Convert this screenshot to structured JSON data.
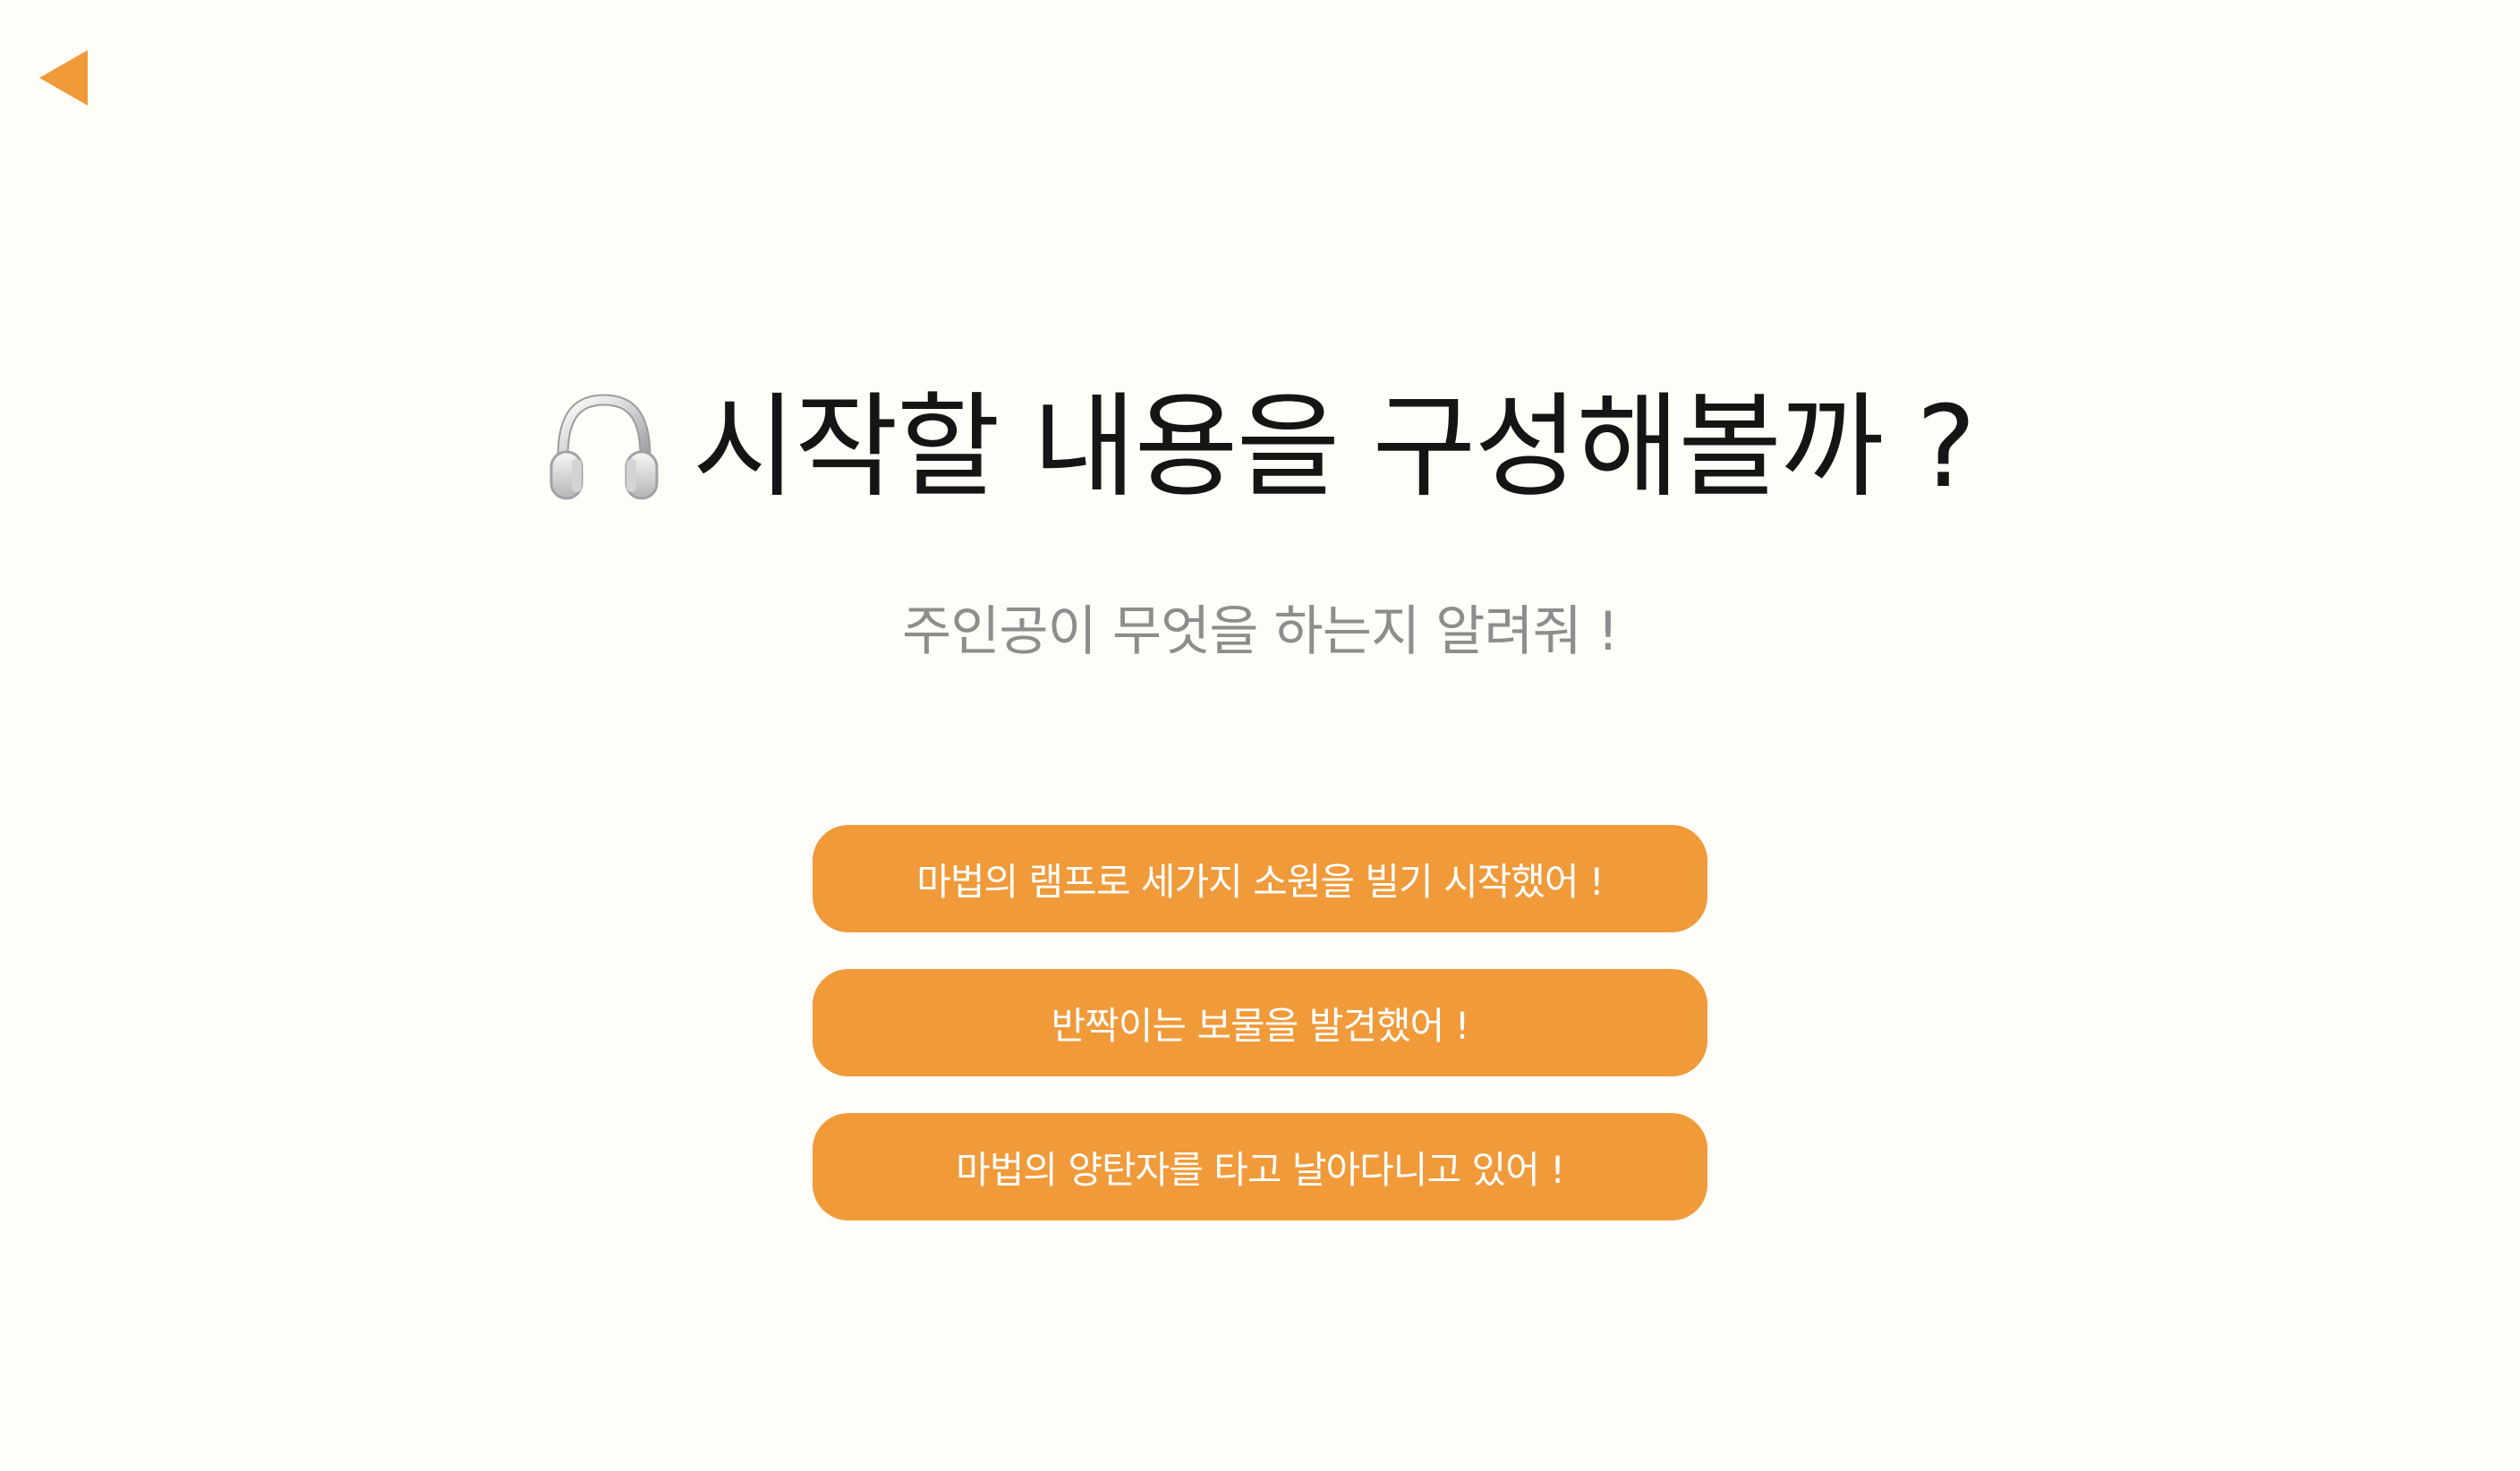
{
  "navigation": {
    "back_icon": "back-triangle-icon",
    "accent_color": "#f09a3a"
  },
  "header": {
    "icon": "headphones-icon",
    "title": "시작할 내용을 구성해볼까 ?",
    "subtitle": "주인공이 무엇을 하는지 알려줘 !"
  },
  "options": [
    {
      "label": "마법의 램프로 세가지 소원을 빌기 시작했어 !"
    },
    {
      "label": "반짝이는 보물을 발견했어 !"
    },
    {
      "label": "마법의 양탄자를 타고 날아다니고 있어 !"
    }
  ],
  "colors": {
    "background": "#fffdf7",
    "button": "#f09a3a",
    "title": "#151515",
    "subtitle": "#8d8d8d"
  }
}
